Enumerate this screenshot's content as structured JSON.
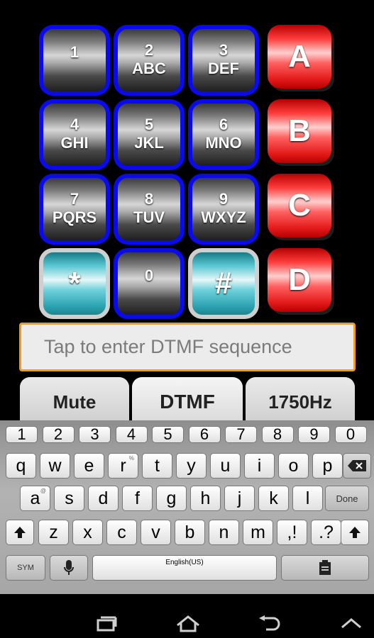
{
  "keypad": {
    "rows": [
      [
        {
          "num": "1",
          "letters": ""
        },
        {
          "num": "2",
          "letters": "ABC"
        },
        {
          "num": "3",
          "letters": "DEF"
        },
        {
          "big": "A"
        }
      ],
      [
        {
          "num": "4",
          "letters": "GHI"
        },
        {
          "num": "5",
          "letters": "JKL"
        },
        {
          "num": "6",
          "letters": "MNO"
        },
        {
          "big": "B"
        }
      ],
      [
        {
          "num": "7",
          "letters": "PQRS"
        },
        {
          "num": "8",
          "letters": "TUV"
        },
        {
          "num": "9",
          "letters": "WXYZ"
        },
        {
          "big": "C"
        }
      ],
      [
        {
          "sym": "*"
        },
        {
          "num": "0",
          "letters": ""
        },
        {
          "sym": "#"
        },
        {
          "big": "D"
        }
      ]
    ]
  },
  "input": {
    "placeholder": "Tap to enter DTMF sequence"
  },
  "tabs": [
    {
      "label": "Mute",
      "active": false
    },
    {
      "label": "DTMF",
      "active": true
    },
    {
      "label": "1750Hz",
      "active": false
    }
  ],
  "keyboard": {
    "numbers": [
      "1",
      "2",
      "3",
      "4",
      "5",
      "6",
      "7",
      "8",
      "9",
      "0"
    ],
    "row1": [
      "q",
      "w",
      "e",
      "r",
      "t",
      "y",
      "u",
      "i",
      "o",
      "p"
    ],
    "row1_hints": [
      "",
      "",
      "",
      "%",
      "",
      "",
      "",
      "",
      "",
      ""
    ],
    "row2": [
      "a",
      "s",
      "d",
      "f",
      "g",
      "h",
      "j",
      "k",
      "l"
    ],
    "row2_hints": [
      "@",
      "",
      "",
      "",
      "",
      "",
      "",
      "",
      ""
    ],
    "row3": [
      "z",
      "x",
      "c",
      "v",
      "b",
      "n",
      "m",
      ",!",
      ".?"
    ],
    "done_label": "Done",
    "sym_label": "SYM",
    "space_label": "English(US)"
  },
  "colors": {
    "keypad_border": "#0a0aee",
    "special_keys": "#5cc8d3",
    "letter_keys": "#ff3c3c",
    "input_border": "#f39a1e"
  }
}
